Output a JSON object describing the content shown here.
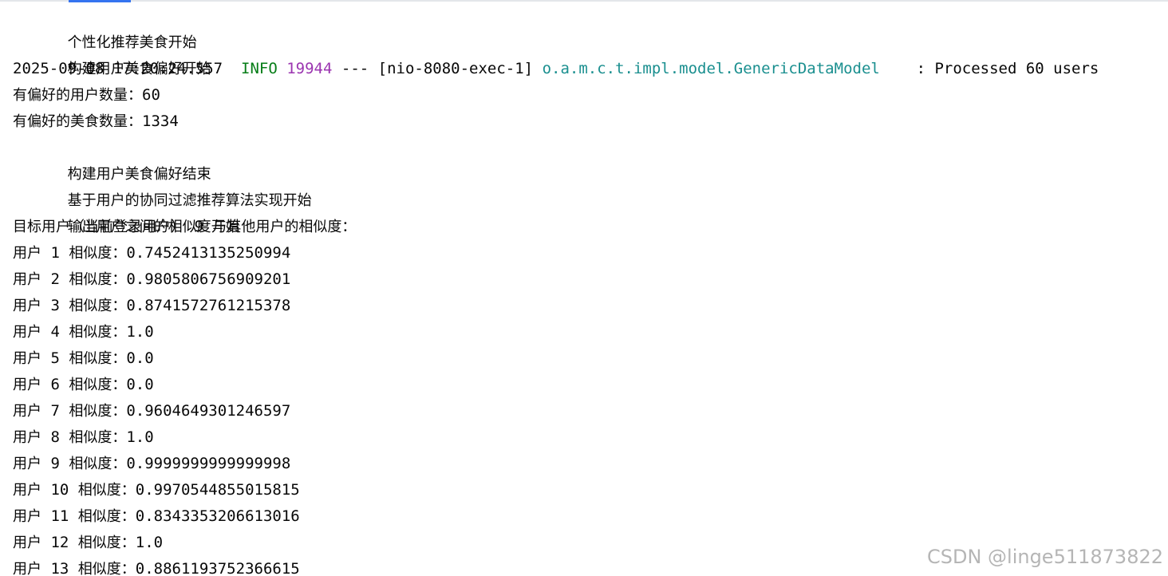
{
  "console": {
    "intro_lines": [
      "个性化推荐美食开始",
      "构建用户美食偏好开始"
    ],
    "log_line": {
      "timestamp": "2025-09-08 17:20:24.557",
      "level": "INFO",
      "pid": "19944",
      "separator": "---",
      "thread": "[nio-8080-exec-1]",
      "logger": "o.a.m.c.t.impl.model.GenericDataModel",
      "message": ": Processed 60 users"
    },
    "status_lines": [
      {
        "label": "有偏好的用户数量：",
        "value": "60"
      },
      {
        "label": "有偏好的美食数量：",
        "value": "1334"
      }
    ],
    "mid_lines": [
      "构建用户美食偏好结束",
      "基于用户的协同过滤推荐算法实现开始",
      "输出用户之间的相似度开始"
    ],
    "target_line": {
      "prefix": "目标用户（当前登录用户）",
      "user_id": " 9 ",
      "suffix": "与其他用户的相似度："
    },
    "user_label": "用户",
    "similarity_label": "相似度：",
    "similarities": [
      {
        "user": "1",
        "value": "0.7452413135250994"
      },
      {
        "user": "2",
        "value": "0.9805806756909201"
      },
      {
        "user": "3",
        "value": "0.8741572761215378"
      },
      {
        "user": "4",
        "value": "1.0"
      },
      {
        "user": "5",
        "value": "0.0"
      },
      {
        "user": "6",
        "value": "0.0"
      },
      {
        "user": "7",
        "value": "0.9604649301246597"
      },
      {
        "user": "8",
        "value": "1.0"
      },
      {
        "user": "9",
        "value": "0.9999999999999998"
      },
      {
        "user": "10",
        "value": "0.9970544855015815"
      },
      {
        "user": "11",
        "value": "0.8343353206613016"
      },
      {
        "user": "12",
        "value": "1.0"
      },
      {
        "user": "13",
        "value": "0.8861193752366615"
      }
    ]
  },
  "watermark": "CSDN @linge511873822",
  "colors": {
    "log_level": "#067d17",
    "pid": "#9b35b0",
    "logger": "#1a8f8f",
    "text": "#080808",
    "tab_indicator": "#3574f0"
  }
}
